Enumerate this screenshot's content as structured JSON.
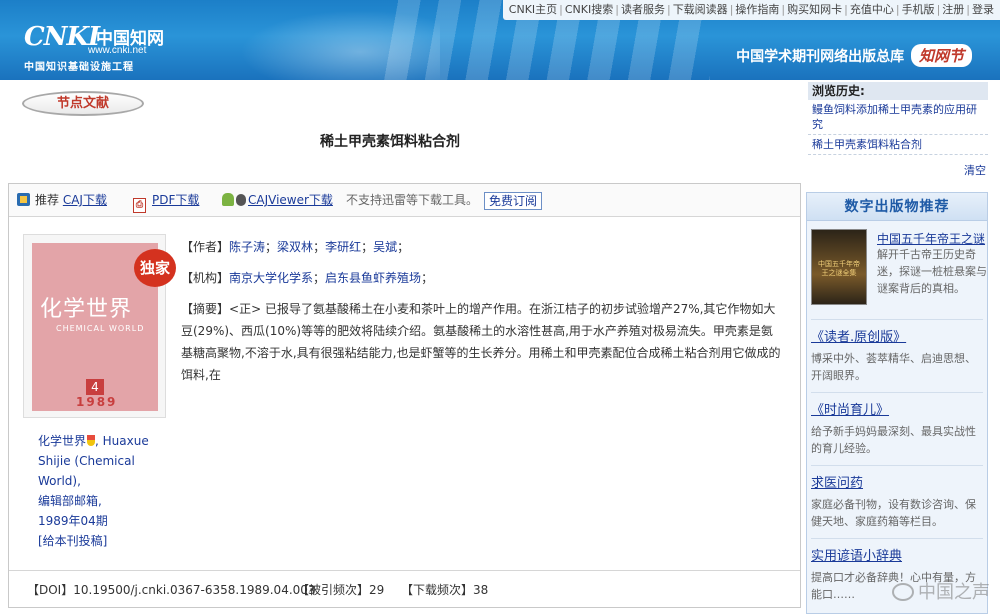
{
  "topnav": [
    "CNKI主页",
    "CNKI搜索",
    "读者服务",
    "下载阅读器",
    "操作指南",
    "购买知网卡",
    "充值中心",
    "手机版",
    "注册",
    "登录"
  ],
  "logo": {
    "brand": "CNKI",
    "cn": "中国知网",
    "url": "www.cnki.net",
    "sub": "中国知识基础设施工程"
  },
  "brand_right": {
    "text": "中国学术期刊网络出版总库",
    "badge": "知网节"
  },
  "node_button": "节点文献",
  "title": "稀土甲壳素饵料粘合剂",
  "toolbar": {
    "recommend": "推荐",
    "caj": "CAJ下载",
    "pdf": "PDF下载",
    "viewer": "CAJViewer下载",
    "notice": "不支持迅雷等下载工具。",
    "subscribe": "免费订阅"
  },
  "cover": {
    "badge": "独家",
    "title_cn": "化学世界",
    "title_en": "CHEMICAL  WORLD",
    "issue": "4",
    "year": "1989"
  },
  "journal": {
    "name": "化学世界",
    "en": ", Huaxue Shijie (Chemical World),",
    "office": "编辑部邮箱,",
    "date": "1989年04期",
    "submit": "[给本刊投稿]"
  },
  "meta": {
    "authors_label": "【作者】",
    "authors": [
      "陈子涛",
      "梁双林",
      "李研红",
      "吴斌"
    ],
    "org_label": "【机构】",
    "orgs": [
      "南京大学化学系",
      "启东县鱼虾养殖场"
    ],
    "abstract_label": "【摘要】",
    "abstract": "<正> 已报导了氨基酸稀土在小麦和茶叶上的增产作用。在浙江桔子的初步试验增产27%,其它作物如大豆(29%)、西瓜(10%)等等的肥效将陆续介绍。氨基酸稀土的水溶性甚高,用于水产养殖对极易流失。甲壳素是氨基糖高聚物,不溶于水,具有很强粘结能力,也是虾蟹等的生长养分。用稀土和甲壳素配位合成稀土粘合剂用它做成的饵料,在"
  },
  "footer": {
    "doi_label": "【DOI】",
    "doi": "10.19500/j.cnki.0367-6358.1989.04.003",
    "cited_label": "【被引频次】",
    "cited": "29",
    "downloads_label": "【下载频次】",
    "downloads": "38"
  },
  "history": {
    "header": "浏览历史:",
    "items": [
      "鳗鱼饲料添加稀土甲壳素的应用研究",
      "稀土甲壳素饵料粘合剂"
    ],
    "clear": "清空"
  },
  "recommend": {
    "header": "数字出版物推荐",
    "first": {
      "title": "中国五千年帝王之谜",
      "desc": "解开千古帝王历史奇迷，探谜一桩桩悬案与谜案背后的真相。",
      "thumb": "中国五千年帝王之谜全集"
    },
    "items": [
      {
        "title": "《读者.原创版》",
        "desc": "博采中外、荟萃精华、启迪思想、开阔眼界。"
      },
      {
        "title": "《时尚育儿》",
        "desc": "给予新手妈妈最深刻、最具实战性的育儿经验。"
      },
      {
        "title": "求医问药",
        "desc": "家庭必备刊物，设有数诊咨询、保健天地、家庭药箱等栏目。"
      },
      {
        "title": "实用谚语小辞典",
        "desc": "提高口才必备辞典！心中有量，方能口……"
      }
    ]
  },
  "watermark": "中国之声"
}
